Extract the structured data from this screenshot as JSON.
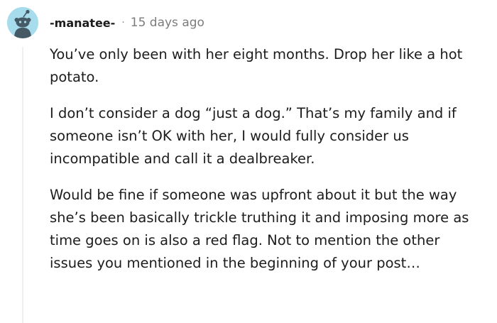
{
  "comment": {
    "avatar": {
      "icon": "snoo-avatar-icon",
      "background": "#a6dcec",
      "figure_color": "#455a64"
    },
    "username": "-manatee-",
    "separator": "·",
    "timestamp": "15 days ago",
    "paragraphs": [
      "You’ve only been with her eight months. Drop her like a hot potato.",
      "I don’t consider a dog “just a dog.” That’s my family and if someone isn’t OK with her, I would fully consider us incompatible and call it a dealbreaker.",
      "Would be fine if someone was upfront about it but the way she’s been basically trickle truthing it and imposing more as time goes on is also a red flag. Not to mention the other issues you mentioned in the beginning of your post…"
    ]
  }
}
